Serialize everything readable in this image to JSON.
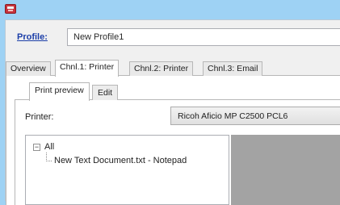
{
  "window": {
    "app_icon": "app-printer-icon"
  },
  "profile": {
    "label": "Profile:",
    "value": "New Profile1"
  },
  "tabs": [
    {
      "label": "Overview"
    },
    {
      "label": "Chnl.1: Printer"
    },
    {
      "label": "Chnl.2: Printer"
    },
    {
      "label": "Chnl.3: Email"
    }
  ],
  "subtabs": [
    {
      "label": "Print preview"
    },
    {
      "label": "Edit"
    }
  ],
  "printer": {
    "label": "Printer:",
    "selected": "Ricoh Aficio MP C2500 PCL6"
  },
  "tree": {
    "toggle": "−",
    "root": "All",
    "child": "New Text Document.txt - Notepad"
  },
  "colors": {
    "title_bar": "#9ed2f4",
    "link": "#1b3ea8",
    "preview_bg": "#a3a3a3"
  }
}
